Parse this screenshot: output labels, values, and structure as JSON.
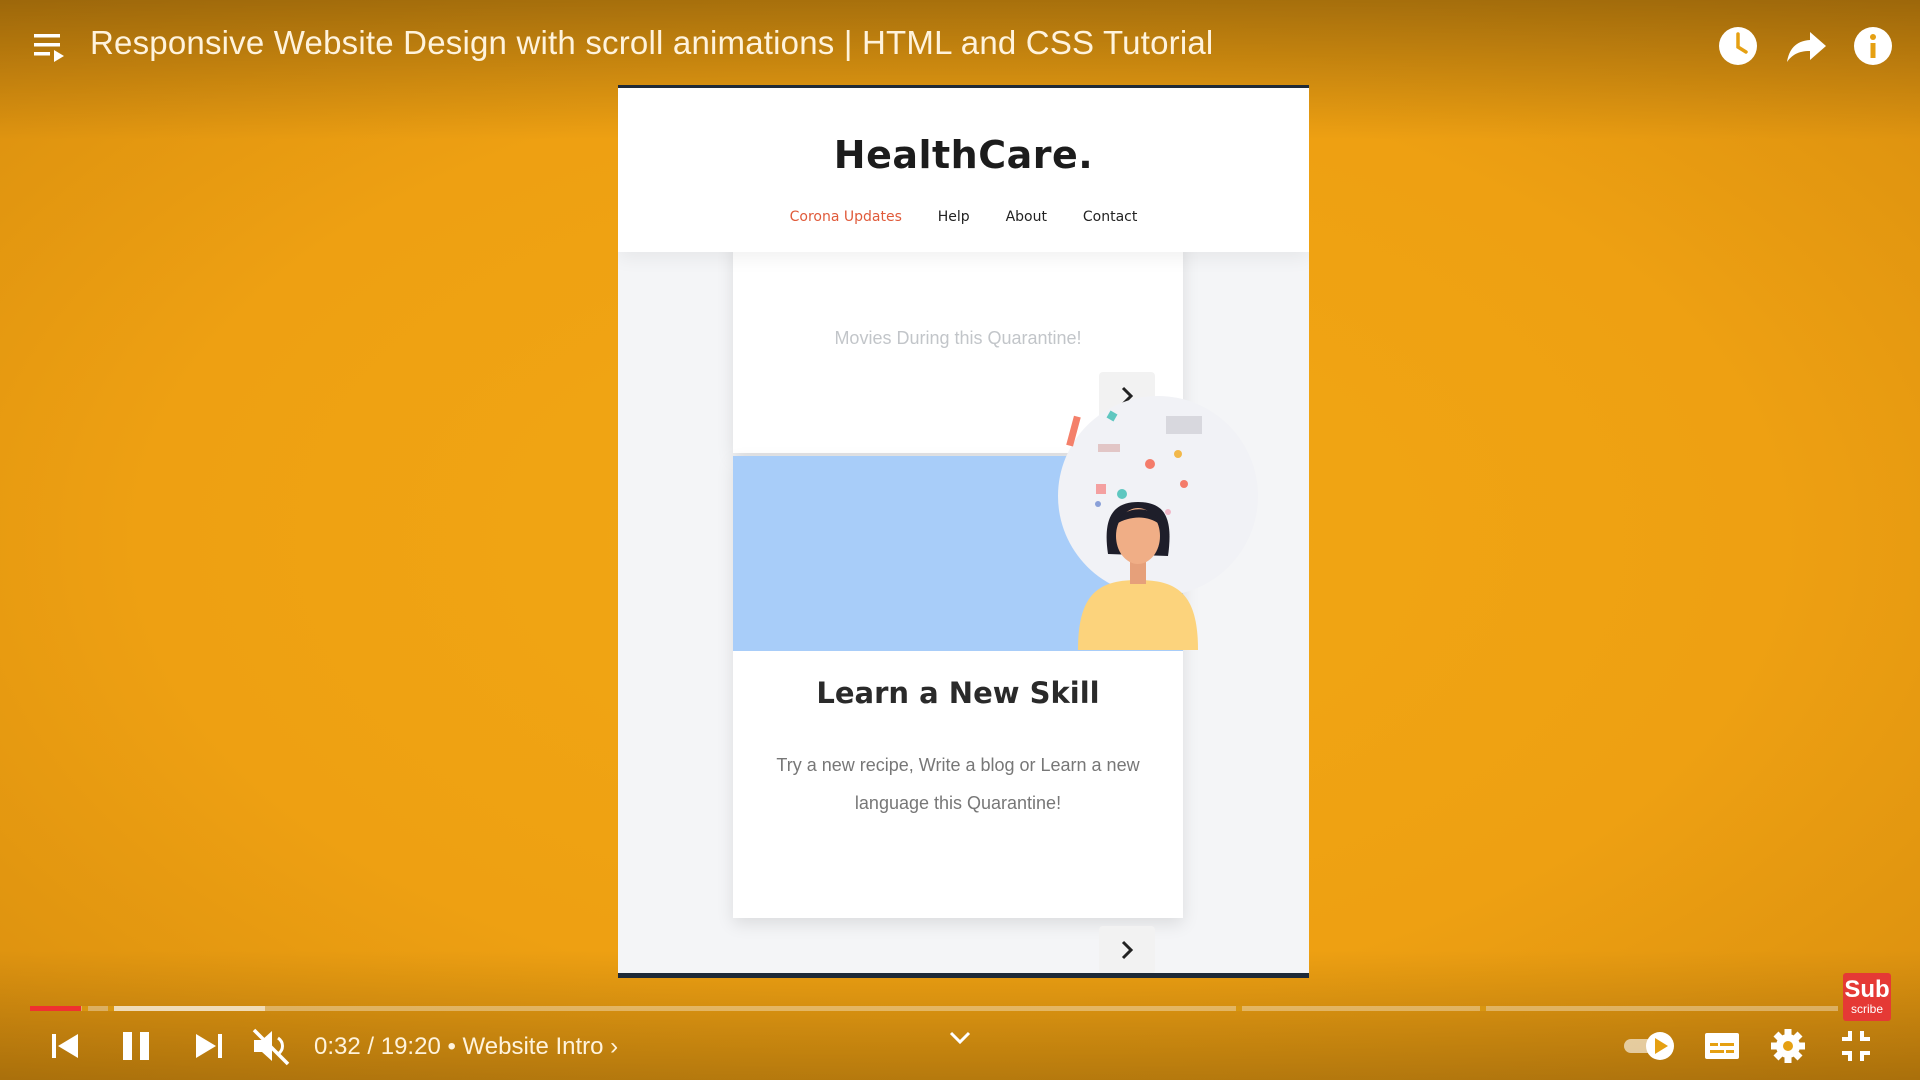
{
  "player": {
    "title": "Responsive Website Design with scroll animations | HTML and CSS Tutorial",
    "time_current": "0:32",
    "time_total": "19:20",
    "chapter": "Website Intro",
    "progress_fraction": 0.028,
    "buffered_until": 0.13,
    "muted": true,
    "accent_color": "#f03030",
    "background_color": "#eea012",
    "top_icons": [
      "clock-icon",
      "share-icon",
      "info-icon"
    ],
    "bottom_icons": [
      "skip-previous-icon",
      "pause-icon",
      "skip-next-icon",
      "volume-muted-icon",
      "autoplay-toggle-icon",
      "captions-icon",
      "settings-gear-icon",
      "exit-fullscreen-icon"
    ]
  },
  "subscribe": {
    "line1": "Sub",
    "line2": "scribe"
  },
  "site": {
    "brand": "HealthCare.",
    "nav": [
      "Corona Updates",
      "Help",
      "About",
      "Contact"
    ],
    "active_nav": "Corona Updates",
    "card_top_cut_text": "Movies During this Quarantine!",
    "card": {
      "title": "Learn a New Skill",
      "desc_line1": "Try a new recipe, Write a blog or Learn a new",
      "desc_line2": "language this Quarantine!"
    }
  }
}
